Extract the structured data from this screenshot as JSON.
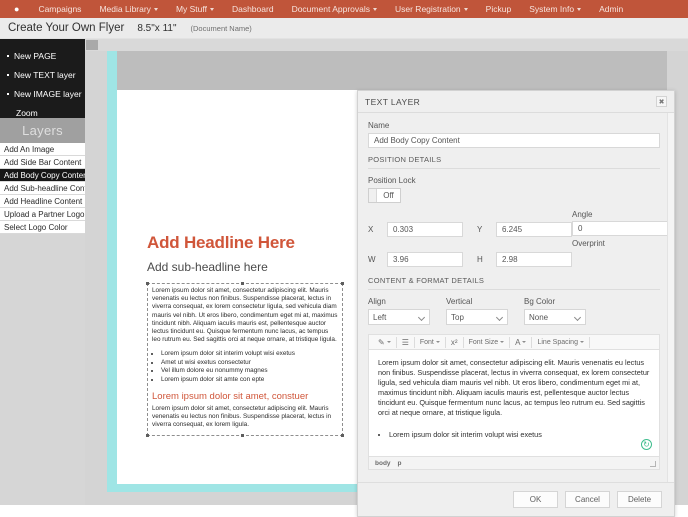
{
  "navbar": {
    "home_icon": "home-icon",
    "items": [
      {
        "label": "Campaigns",
        "caret": false
      },
      {
        "label": "Media Library",
        "caret": true
      },
      {
        "label": "My Stuff",
        "caret": true
      },
      {
        "label": "Dashboard",
        "caret": false
      },
      {
        "label": "Document Approvals",
        "caret": true
      },
      {
        "label": "User Registration",
        "caret": true
      },
      {
        "label": "Pickup",
        "caret": false
      },
      {
        "label": "System Info",
        "caret": true
      },
      {
        "label": "Admin",
        "caret": false
      }
    ]
  },
  "subheader": {
    "title": "Create Your Own Flyer",
    "size": "8.5\"x 11\"",
    "document_name": "(Document Name)"
  },
  "sidebar": {
    "actions": [
      {
        "label": "New PAGE",
        "bullet": true
      },
      {
        "label": "New TEXT layer",
        "bullet": true
      },
      {
        "label": "New IMAGE layer",
        "bullet": true
      },
      {
        "label": "Zoom",
        "bullet": false
      }
    ],
    "layers_header": "Layers",
    "layers": [
      {
        "label": "Add An Image",
        "selected": false
      },
      {
        "label": "Add Side Bar Content",
        "selected": false
      },
      {
        "label": "Add Body Copy Content",
        "selected": true
      },
      {
        "label": "Add Sub-headline Content",
        "selected": false
      },
      {
        "label": "Add Headline Content",
        "selected": false
      },
      {
        "label": "Upload a Partner Logo",
        "selected": false
      },
      {
        "label": "Select Logo Color",
        "selected": false
      }
    ]
  },
  "flyer": {
    "headline": "Add Headline Here",
    "subheadline": "Add sub-headline here",
    "body_copy": "Lorem ipsum dolor sit amet, consectetur adipiscing elit. Mauris venenatis eu lectus non finibus. Suspendisse placerat, lectus in viverra consequat, ex lorem consectetur ligula, sed vehicula diam mauris vel nibh. Ut eros libero, condimentum eget mi at, maximus tincidunt nibh. Aliquam iaculis mauris est, pellentesque auctor lectus tincidunt eu. Quisque fermentum nunc lacus, ac tempus leo rutrum eu. Sed sagittis orci at neque ornare, at tristique ligula.",
    "bullets": [
      "Lorem ipsum dolor sit interim volupt wisi exetus",
      "Amet ut wisi exetus consectetur",
      "Vel illum dolore eu nonummy magnes",
      "Lorem ipsum dolor sit amte con epte"
    ],
    "sub_heading": "Lorem ipsum dolor sit amet, constuer",
    "body_copy2": "Lorem ipsum dolor sit amet, consectetur adipiscing elit. Mauris venenatis eu lectus non finibus. Suspendisse placerat, lectus in viverra consequat, ex lorem ligula."
  },
  "modal": {
    "title": "TEXT LAYER",
    "close_icon": "close-icon",
    "name_label": "Name",
    "name_value": "Add Body Copy Content",
    "position_section": "POSITION DETAILS",
    "position_lock_label": "Position Lock",
    "position_lock_value": "Off",
    "fields": {
      "x_label": "X",
      "x_value": "0.303",
      "y_label": "Y",
      "y_value": "6.245",
      "w_label": "W",
      "w_value": "3.96",
      "h_label": "H",
      "h_value": "2.98",
      "angle_label": "Angle",
      "angle_value": "0",
      "overprint_label": "Overprint"
    },
    "content_section": "CONTENT & FORMAT DETAILS",
    "selects": [
      {
        "label": "Align",
        "value": "Left"
      },
      {
        "label": "Vertical",
        "value": "Top"
      },
      {
        "label": "Bg Color",
        "value": "None"
      }
    ],
    "toolbar": [
      {
        "name": "paste-icon",
        "glyph": "✎",
        "label": "",
        "caret": true
      },
      {
        "name": "list-icon",
        "glyph": "☰",
        "label": "",
        "caret": false
      },
      {
        "name": "font-dropdown",
        "glyph": "",
        "label": "Font",
        "caret": true
      },
      {
        "name": "superscript-icon",
        "glyph": "x²",
        "label": "",
        "caret": false
      },
      {
        "name": "font-size-dropdown",
        "glyph": "",
        "label": "Font Size",
        "caret": true
      },
      {
        "name": "text-color-icon",
        "glyph": "A",
        "label": "",
        "caret": true
      },
      {
        "name": "line-spacing-dropdown",
        "glyph": "",
        "label": "Line Spacing",
        "caret": true
      }
    ],
    "editor": {
      "paragraph": "Lorem ipsum dolor sit amet, consectetur adipiscing elit. Mauris venenatis eu lectus non finibus. Suspendisse placerat, lectus in viverra consequat, ex lorem consectetur ligula, sed vehicula diam mauris vel nibh. Ut eros libero, condimentum eget mi at, maximus tincidunt nibh. Aliquam iaculis mauris est, pellentesque auctor lectus tincidunt eu. Quisque fermentum nunc lacus, ac tempus leo rutrum eu. Sed sagittis orci at neque ornare, at tristique ligula.",
      "bullets": [
        "Lorem ipsum dolor sit interim volupt wisi exetus"
      ],
      "status_crumbs": [
        "body",
        "p"
      ],
      "watermark_icon": "ckeditor-logo-icon"
    },
    "buttons": [
      {
        "label": "OK",
        "name": "ok-button"
      },
      {
        "label": "Cancel",
        "name": "cancel-button"
      },
      {
        "label": "Delete",
        "name": "delete-button"
      }
    ]
  },
  "colors": {
    "navbar": "#c0553a",
    "headline": "#d0563a",
    "page_border": "#9fe5e5",
    "selected_layer": "#161616"
  }
}
